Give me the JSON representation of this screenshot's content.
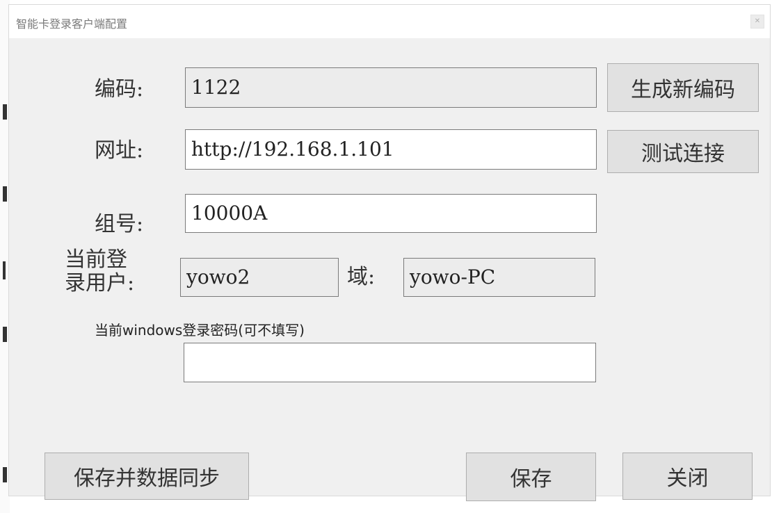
{
  "window": {
    "title": "智能卡登录客户端配置",
    "close_icon": "close-icon"
  },
  "form": {
    "code": {
      "label": "编码:",
      "value": "1122"
    },
    "url": {
      "label": "网址:",
      "value": "http://192.168.1.101"
    },
    "group": {
      "label": "组号:",
      "value": "10000A"
    },
    "current_user": {
      "label_line1": "当前登",
      "label_line2": "录用户:",
      "value": "yowo2"
    },
    "domain": {
      "label": "域:",
      "value": "yowo-PC"
    },
    "password": {
      "label": "当前windows登录密码(可不填写)",
      "value": ""
    }
  },
  "buttons": {
    "generate_code": "生成新编码",
    "test_connection": "测试连接",
    "save_and_sync": "保存并数据同步",
    "save": "保存",
    "close": "关闭"
  }
}
